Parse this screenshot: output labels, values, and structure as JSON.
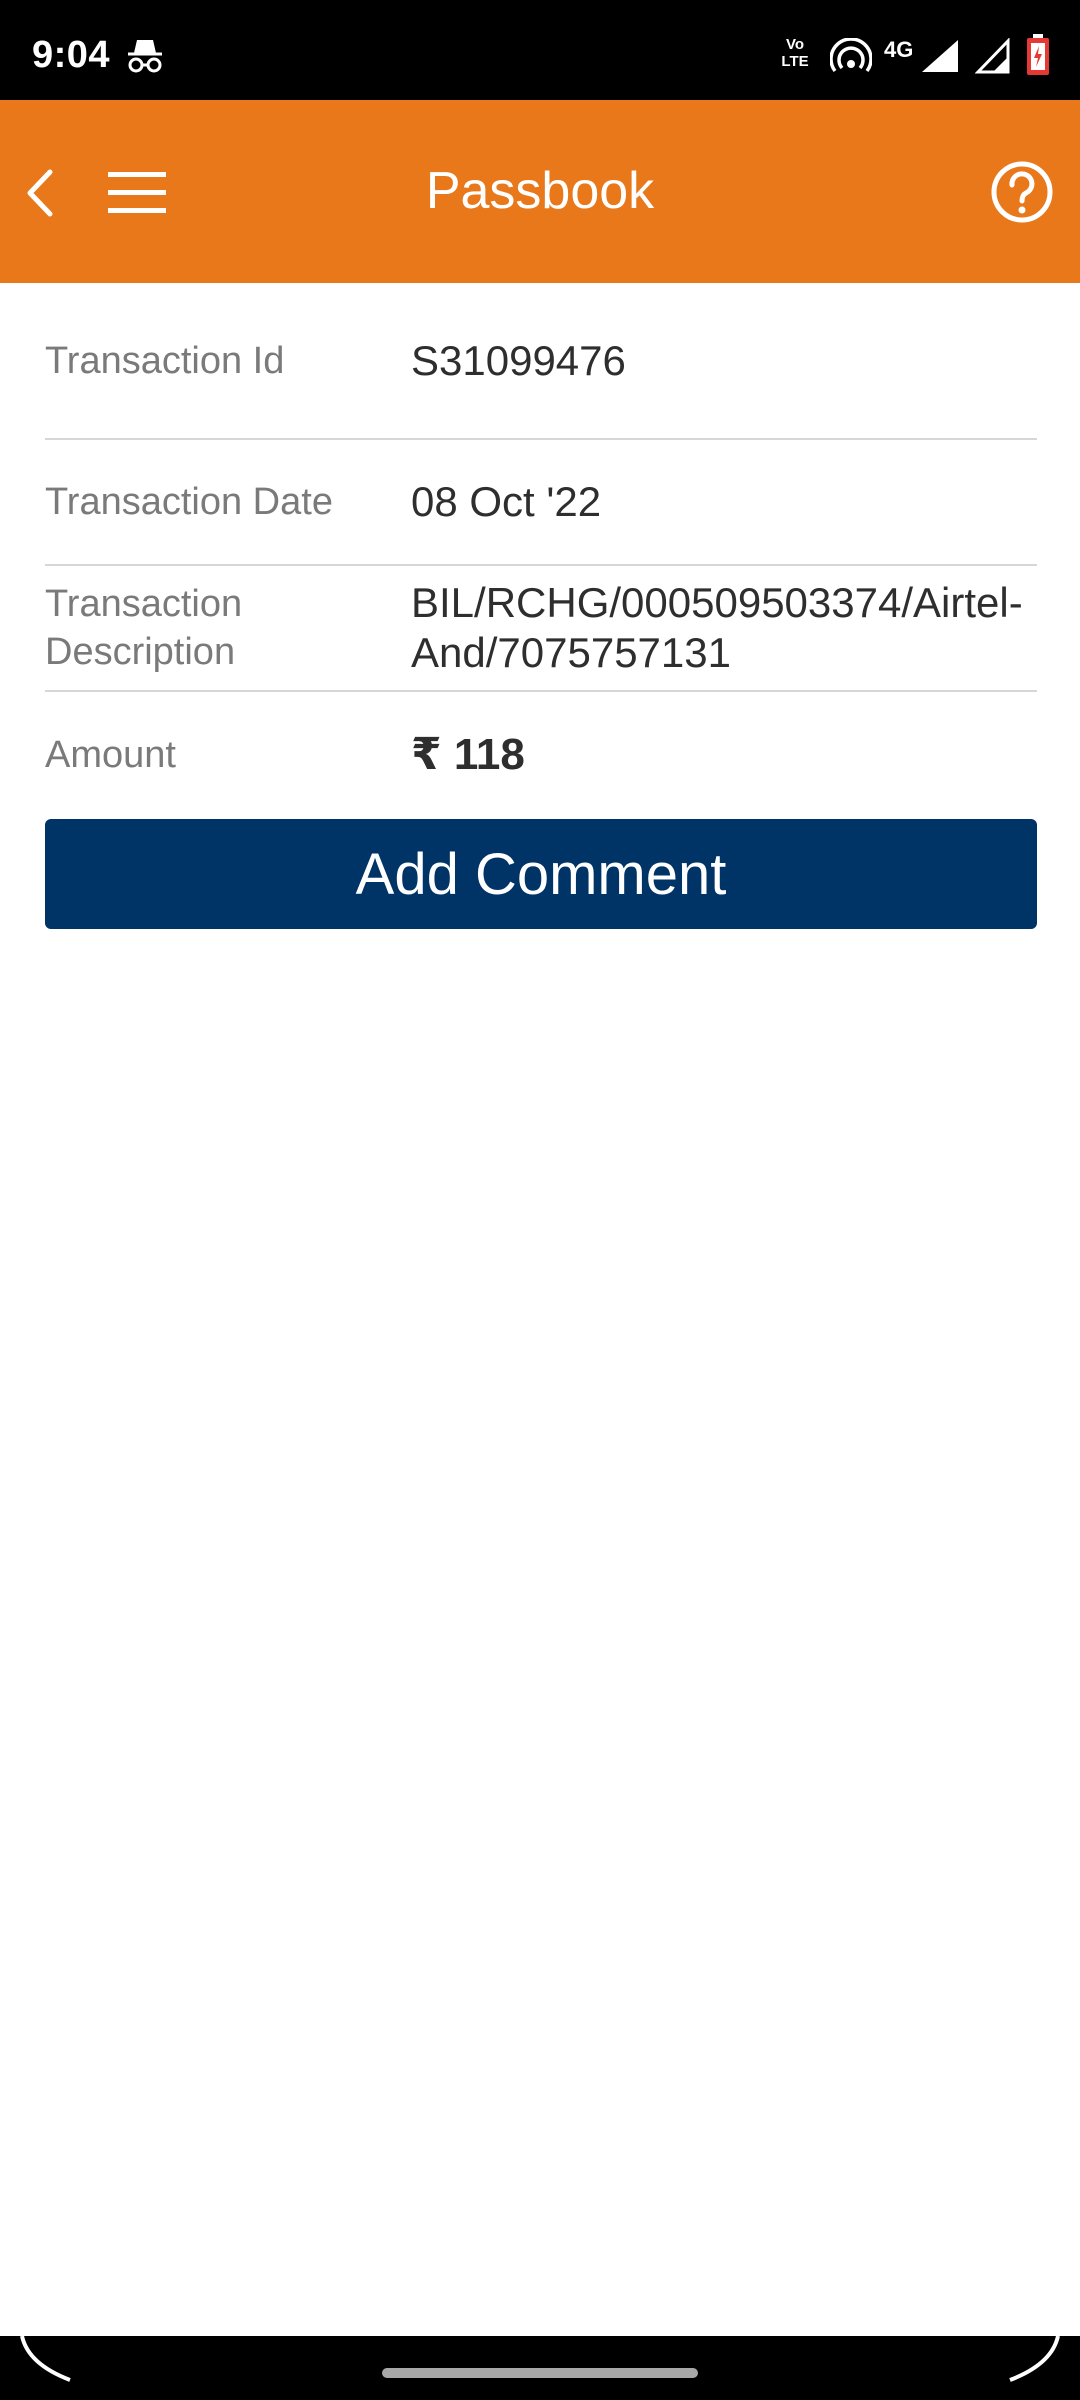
{
  "status_bar": {
    "time": "9:04",
    "volte": "Vo\nLTE",
    "network_type": "4G",
    "icons": [
      "incognito-icon",
      "hotspot-icon",
      "signal-icon",
      "battery-icon"
    ]
  },
  "app_bar": {
    "title": "Passbook",
    "color": "#e8781a",
    "icons": [
      "back-icon",
      "menu-icon",
      "help-icon"
    ]
  },
  "transaction": {
    "rows": [
      {
        "label": "Transaction Id",
        "value": "S31099476"
      },
      {
        "label": "Transaction Date",
        "value": "08 Oct '22"
      },
      {
        "label": "Transaction Description",
        "value": "BIL/RCHG/000509503374/Airtel-And/7075757131"
      },
      {
        "label": "Amount",
        "value": "₹ 118"
      }
    ]
  },
  "actions": {
    "add_comment_label": "Add Comment",
    "button_color": "#003366"
  }
}
